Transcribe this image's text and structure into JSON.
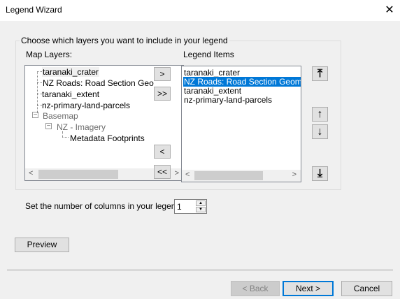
{
  "window": {
    "title": "Legend Wizard",
    "close_icon": "close-icon"
  },
  "group": {
    "label": "Choose which layers you want to include in your legend"
  },
  "map_layers": {
    "label": "Map Layers:",
    "items": [
      "taranaki_crater",
      "NZ Roads: Road Section Geo",
      "taranaki_extent",
      "nz-primary-land-parcels",
      "Basemap",
      "NZ - Imagery",
      "Metadata Footprints"
    ]
  },
  "legend_items": {
    "label": "Legend Items",
    "items": [
      "taranaki_crater",
      "NZ Roads: Road Section Geometry",
      "taranaki_extent",
      "nz-primary-land-parcels"
    ],
    "selected": "NZ Roads: Road Section Geometry"
  },
  "transfer": {
    "add": ">",
    "add_all": ">>",
    "remove": "<",
    "remove_all": "<<"
  },
  "order": {
    "top": "⤒",
    "up": "↑",
    "down": "↓",
    "bottom": "⤓"
  },
  "columns": {
    "label": "Set the number of columns in your legend:",
    "value": "1"
  },
  "buttons": {
    "preview": "Preview",
    "back": "< Back",
    "next": "Next >",
    "cancel": "Cancel"
  },
  "scroll": {
    "left": "<",
    "right": ">"
  },
  "colors": {
    "selection": "#0078d7",
    "accent_border": "#0078d7"
  }
}
